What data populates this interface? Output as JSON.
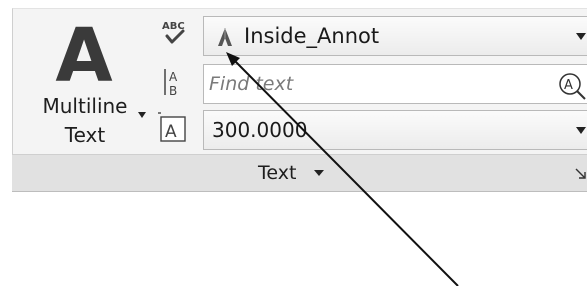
{
  "multiline_text": {
    "glyph": "A",
    "label_line1": "Multiline",
    "label_line2": "Text"
  },
  "text_style": {
    "value": "Inside_Annot",
    "icon": "annotative-text-style-icon"
  },
  "find": {
    "placeholder": "Find text"
  },
  "text_height": {
    "value": "300.0000"
  },
  "panel": {
    "title": "Text"
  },
  "icons": {
    "spell_check": "abc-check-spelling-icon",
    "find_replace": "find-replace-icon",
    "text_height": "text-height-icon",
    "dialog_launcher": "dialog-launcher-icon"
  }
}
